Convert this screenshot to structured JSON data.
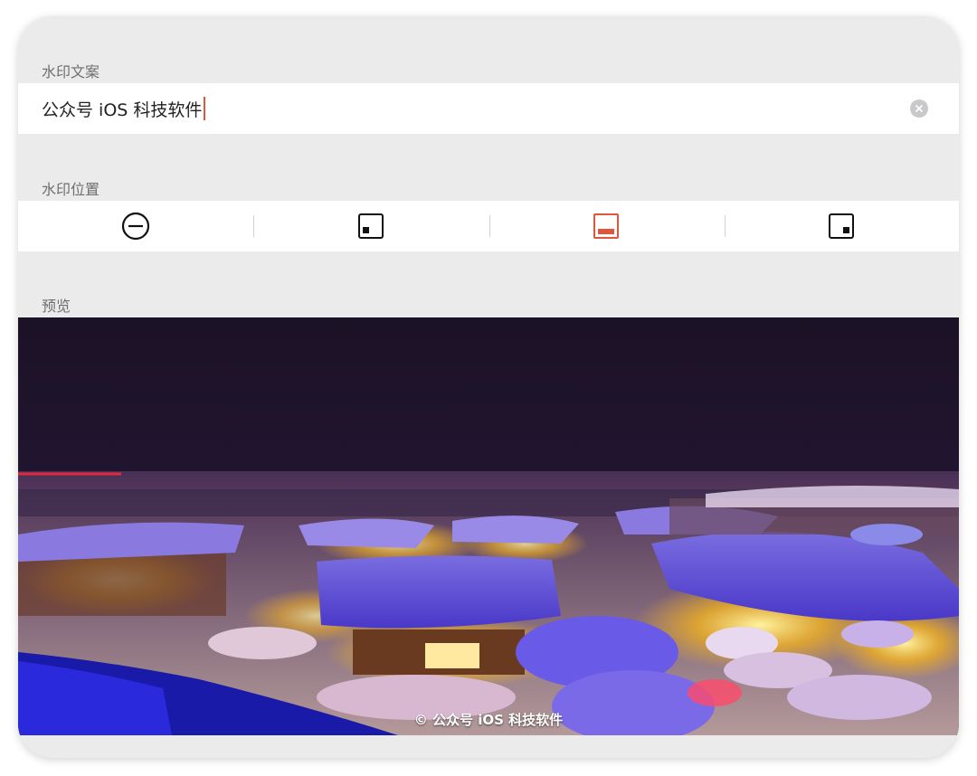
{
  "labels": {
    "watermark_text_section": "水印文案",
    "watermark_position_section": "水印位置",
    "preview_section": "预览"
  },
  "text_input": {
    "value": "公众号 iOS 科技软件"
  },
  "position_options": [
    {
      "name": "none",
      "icon": "no-watermark-icon",
      "selected": false
    },
    {
      "name": "bottom-left",
      "icon": "position-bottom-left-icon",
      "selected": false
    },
    {
      "name": "bottom-center",
      "icon": "position-bottom-center-icon",
      "selected": true
    },
    {
      "name": "bottom-right",
      "icon": "position-bottom-right-icon",
      "selected": false
    }
  ],
  "preview": {
    "watermark": "© 公众号 iOS 科技软件"
  },
  "colors": {
    "accent": "#e0563c",
    "background": "#ebebeb",
    "row_background": "#ffffff",
    "label": "#6e6e6e"
  }
}
